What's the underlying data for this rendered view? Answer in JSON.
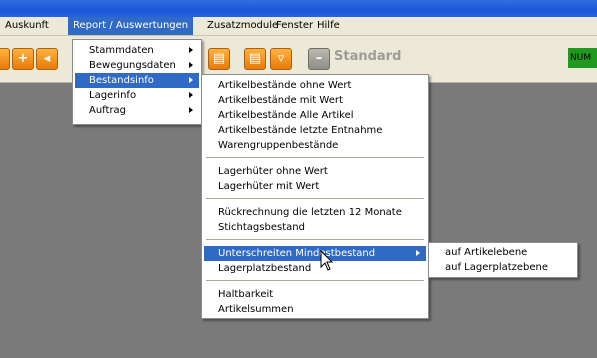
{
  "menubar": {
    "items": [
      {
        "label": "Auskunft"
      },
      {
        "label": "Report / Auswertungen"
      },
      {
        "label": "Zusatzmodule"
      },
      {
        "label": "Fenster"
      },
      {
        "label": "Hilfe"
      }
    ]
  },
  "toolbar": {
    "standard_label": "Standard",
    "status_indicator": "NUM",
    "icons": [
      "orange-tool-icon",
      "add-icon",
      "orange-tool-icon",
      "copy-icon",
      "copy-icon",
      "gem-icon",
      "standard-icon"
    ]
  },
  "report_menu": {
    "items": [
      {
        "label": "Stammdaten"
      },
      {
        "label": "Bewegungsdaten"
      },
      {
        "label": "Bestandsinfo"
      },
      {
        "label": "Lagerinfo"
      },
      {
        "label": "Auftrag"
      }
    ]
  },
  "bestandsinfo_menu": {
    "items": [
      {
        "label": "Artikelbestände ohne Wert"
      },
      {
        "label": "Artikelbestände mit Wert"
      },
      {
        "label": "Artikelbestände Alle Artikel"
      },
      {
        "label": "Artikelbestände letzte Entnahme"
      },
      {
        "label": "Warengruppenbestände"
      },
      {
        "label": "Lagerhüter ohne Wert"
      },
      {
        "label": "Lagerhüter mit Wert"
      },
      {
        "label": "Rückrechnung die letzten 12 Monate"
      },
      {
        "label": "Stichtagsbestand"
      },
      {
        "label": "Unterschreiten Mindestbestand"
      },
      {
        "label": "Lagerplatzbestand"
      },
      {
        "label": "Haltbarkeit"
      },
      {
        "label": "Artikelsummen"
      }
    ]
  },
  "mindestbestand_menu": {
    "items": [
      {
        "label": "auf Artikelebene"
      },
      {
        "label": "auf Lagerplatzebene"
      }
    ]
  },
  "colors": {
    "highlight": "#316ac5",
    "menubar": "#ece9d8",
    "workspace": "#7a7a7a",
    "titlebar": "#1a56d6",
    "status_green": "#1f9a1f"
  }
}
